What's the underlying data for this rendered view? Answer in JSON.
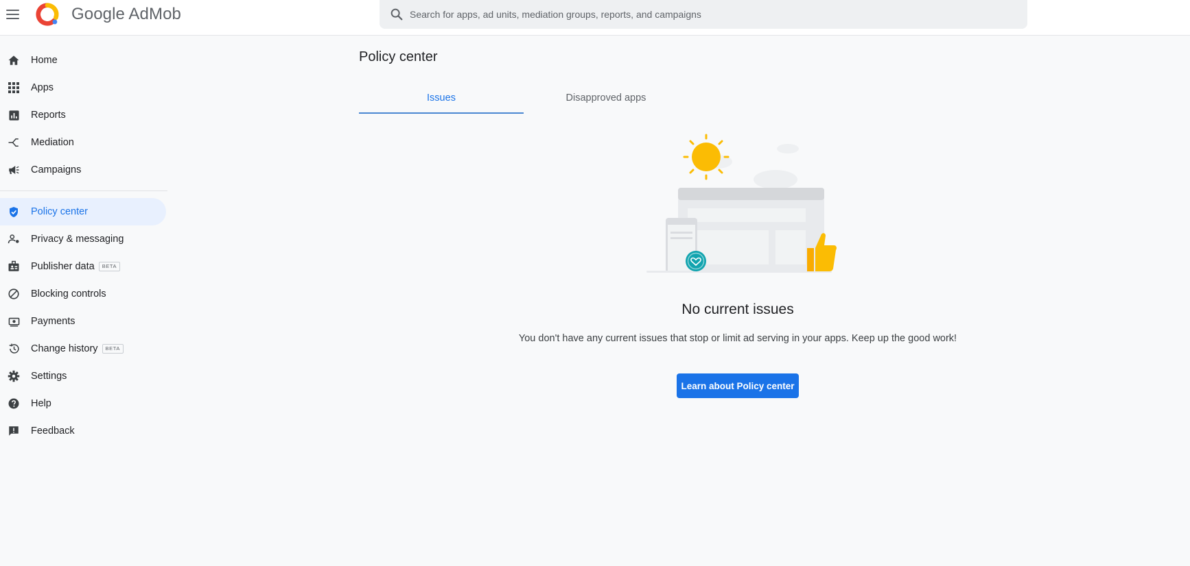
{
  "header": {
    "brand": "Google AdMob",
    "search_placeholder": "Search for apps, ad units, mediation groups, reports, and campaigns"
  },
  "sidebar": {
    "items": [
      {
        "label": "Home",
        "icon": "home-icon"
      },
      {
        "label": "Apps",
        "icon": "apps-grid-icon"
      },
      {
        "label": "Reports",
        "icon": "reports-icon"
      },
      {
        "label": "Mediation",
        "icon": "mediation-icon"
      },
      {
        "label": "Campaigns",
        "icon": "campaigns-icon"
      },
      {
        "label": "Policy center",
        "icon": "shield-check-icon",
        "active": true
      },
      {
        "label": "Privacy & messaging",
        "icon": "privacy-icon"
      },
      {
        "label": "Publisher data",
        "icon": "publisher-data-icon",
        "badge": "BETA"
      },
      {
        "label": "Blocking controls",
        "icon": "block-icon"
      },
      {
        "label": "Payments",
        "icon": "payments-icon"
      },
      {
        "label": "Change history",
        "icon": "history-icon",
        "badge": "BETA"
      },
      {
        "label": "Settings",
        "icon": "gear-icon"
      },
      {
        "label": "Help",
        "icon": "help-icon"
      },
      {
        "label": "Feedback",
        "icon": "feedback-icon"
      }
    ]
  },
  "main": {
    "title": "Policy center",
    "tabs": [
      {
        "label": "Issues",
        "active": true
      },
      {
        "label": "Disapproved apps",
        "active": false
      }
    ],
    "empty_state": {
      "title": "No current issues",
      "description": "You don't have any current issues that stop or limit ad serving in your apps. Keep up the good work!",
      "button_label": "Learn about Policy center"
    }
  },
  "colors": {
    "accent": "#1a73e8",
    "active_nav_bg": "#e8f0fe",
    "page_bg": "#f8f9fa"
  }
}
